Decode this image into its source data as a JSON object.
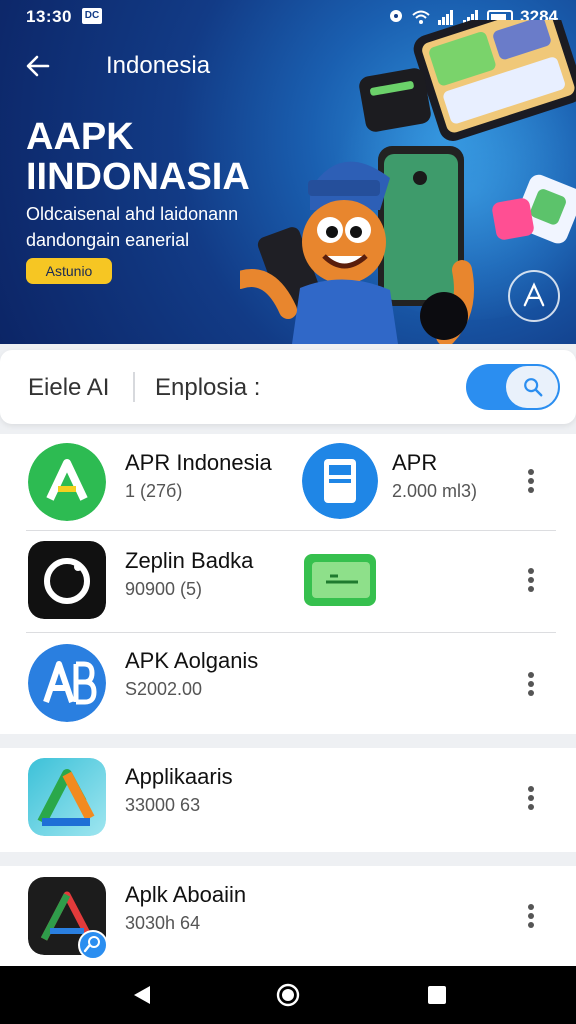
{
  "status_bar": {
    "time": "13:30",
    "sim_label": "DC",
    "battery": "3284"
  },
  "header": {
    "title": "Indonesia"
  },
  "hero": {
    "headline_line1": "AAPK",
    "headline_line2": "IINDONASIA",
    "tagline_line1": "Oldcaisenal ahd laidonann",
    "tagline_line2": "dandongain eanerial",
    "button_label": "Astunio"
  },
  "search": {
    "left_label": "Eiele AI",
    "right_label": "Enplosia :"
  },
  "apps": [
    {
      "name": "APR Indonesia",
      "meta": "1 (27б)",
      "icon": "green-a-icon",
      "accent": "#2dbb52"
    },
    {
      "name": "APR",
      "meta": "2.000 ml3)",
      "icon": "blue-device-icon",
      "accent": "#1f86e6"
    },
    {
      "name": "Zeplin Badka",
      "meta": "90900 (5)",
      "icon": "black-ring-icon",
      "accent": "#111111"
    },
    {
      "name": "APK Aolganis",
      "meta": "S2002.00",
      "icon": "blue-ab-icon",
      "accent": "#2a7fe0"
    },
    {
      "name": "Applikaaris",
      "meta": "33000 63",
      "icon": "green-a-icon",
      "accent": "#3cc1d8"
    },
    {
      "name": "Aplk Aboaiin",
      "meta": "3030h 64",
      "icon": "dark-a-icon",
      "accent": "#1c1c1c"
    }
  ],
  "colors": {
    "accent_blue": "#2b8ef0",
    "hero_dark": "#0c2566",
    "pill_yellow": "#f6c623"
  }
}
